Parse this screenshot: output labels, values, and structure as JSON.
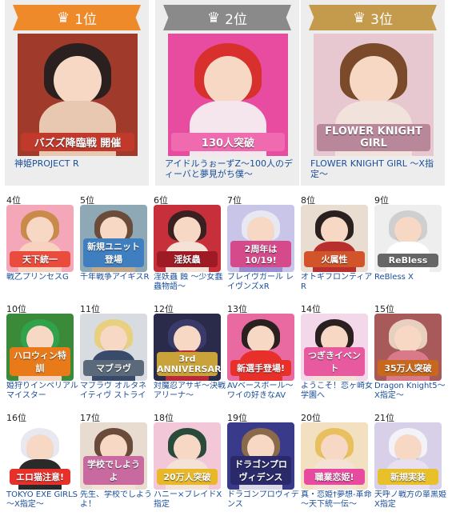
{
  "top": [
    {
      "rank": "1位",
      "title": "神姫PROJECT R",
      "badge": "バズズ降臨戦 開催",
      "ribbon_color": "#ee8a2a",
      "bg": "#a03a2a",
      "hair": "#2a2020",
      "body": "#e8c8b0",
      "badge_bg": "#c0392b"
    },
    {
      "rank": "2位",
      "title": "アイドルうぉーずZ～100人のディーバと夢見がち僕～",
      "badge": "130人突破",
      "ribbon_color": "#8a8a8a",
      "bg": "#e84ca0",
      "hair": "#d8302c",
      "body": "#f5e6ee",
      "badge_bg": "#f06ab0"
    },
    {
      "rank": "3位",
      "title": "FLOWER KNIGHT GIRL ～X指定～",
      "badge": "FLOWER KNIGHT GIRL",
      "ribbon_color": "#c49a4c",
      "bg": "#e8c8d0",
      "hair": "#7a4a2a",
      "body": "#f2e2dc",
      "badge_bg": "#b8889a"
    }
  ],
  "items": [
    {
      "rank": "4位",
      "title": "戦乙プリンセスG",
      "badge": "天下統一",
      "bg": "#f4a7b9",
      "hair": "#c98a4a",
      "body": "#f6d2bf",
      "badge_bg": "#e94b3c"
    },
    {
      "rank": "5位",
      "title": "千年戦争アイギスR",
      "badge": "新規ユニット登場",
      "bg": "#8fa8b5",
      "hair": "#6b4b3a",
      "body": "#c4a88a",
      "badge_bg": "#3f7fbf"
    },
    {
      "rank": "6位",
      "title": "淫妖蟲 蝕 ～少女蠢蟲物語～",
      "badge": "淫妖蟲",
      "bg": "#c7303a",
      "hair": "#3a2020",
      "body": "#f4e2d6",
      "badge_bg": "#9e1b25"
    },
    {
      "rank": "7位",
      "title": "ブレイヴガール レイヴンズxR",
      "badge": "2周年は10/19!",
      "bg": "#c9c5e8",
      "hair": "#e8e8f2",
      "body": "#9a8fd0",
      "badge_bg": "#d44a8a"
    },
    {
      "rank": "8位",
      "title": "オトギフロンティア R",
      "badge": "火属性",
      "bg": "#e9dcd0",
      "hair": "#2a2020",
      "body": "#b8302e",
      "badge_bg": "#d2542a"
    },
    {
      "rank": "9位",
      "title": "ReBless X",
      "badge": "ReBless",
      "bg": "#eeeeee",
      "hair": "#cfcfcf",
      "body": "#ffffff",
      "badge_bg": "#666666"
    },
    {
      "rank": "10位",
      "title": "姫狩りインペリアルマイスター",
      "badge": "ハロウィン特訓",
      "bg": "#3a8a3a",
      "hair": "#2fa24a",
      "body": "#f4d5c2",
      "badge_bg": "#e87a1a"
    },
    {
      "rank": "11位",
      "title": "マブラヴ オルタネイティヴ ストライ",
      "badge": "マブラヴ",
      "bg": "#d8dce0",
      "hair": "#e8d080",
      "body": "#3a4a6a",
      "badge_bg": "#5a6a7a"
    },
    {
      "rank": "12位",
      "title": "対魔忍アサギ～決戦アリーナ～",
      "badge": "3rd ANNIVERSARY",
      "bg": "#2a2a4a",
      "hair": "#3a3a6a",
      "body": "#b82a3a",
      "badge_bg": "#c9a23a"
    },
    {
      "rank": "13位",
      "title": "AVベースボール～ワイの好きなAV",
      "badge": "新選手登場!",
      "bg": "#e86aa0",
      "hair": "#2a2020",
      "body": "#e8302a",
      "badge_bg": "#e8302a"
    },
    {
      "rank": "14位",
      "title": "ようこそ！恋ヶ崎女学園へ",
      "badge": "つぎきイベント",
      "bg": "#f2d8e8",
      "hair": "#2a2020",
      "body": "#f4e2d6",
      "badge_bg": "#e85aa0"
    },
    {
      "rank": "15位",
      "title": "Dragon Knight5～X指定～",
      "badge": "35万人突破",
      "bg": "#a85a5a",
      "hair": "#e8d0c0",
      "body": "#d87a8a",
      "badge_bg": "#c8681e"
    },
    {
      "rank": "16位",
      "title": "TOKYO EXE GIRLS ～X指定～",
      "badge": "エロ猫注意!",
      "bg": "#ffffff",
      "hair": "#e8e8f0",
      "body": "#2a2a2a",
      "badge_bg": "#e8302a"
    },
    {
      "rank": "17位",
      "title": "先生、学校でしようよ！",
      "badge": "学校でしようよ",
      "bg": "#e8dcd0",
      "hair": "#6a4a3a",
      "body": "#f4e2d6",
      "badge_bg": "#c86aa0"
    },
    {
      "rank": "18位",
      "title": "ハニー×ブレイドX指定",
      "badge": "20万人突破",
      "bg": "#f2c8d8",
      "hair": "#2a4a3a",
      "body": "#f4e2d6",
      "badge_bg": "#e8b82a"
    },
    {
      "rank": "19位",
      "title": "ドラゴンプロヴィデンス",
      "badge": "ドラゴンプロヴィデンス",
      "bg": "#3a3a8a",
      "hair": "#8a6a4a",
      "body": "#d8d8e8",
      "badge_bg": "#2a2a6a"
    },
    {
      "rank": "20位",
      "title": "真・恋姫†夢想-革命～天下統一伝～",
      "badge": "職業恋姫!",
      "bg": "#f2e0c0",
      "hair": "#e8c060",
      "body": "#f4e2d6",
      "badge_bg": "#e84aa0"
    },
    {
      "rank": "21位",
      "title": "天呼ノ戦方の箪黒姫 X指定",
      "badge": "新規実装",
      "bg": "#d8d0e8",
      "hair": "#f2f2f8",
      "body": "#e8e0f0",
      "badge_bg": "#e8c02a"
    }
  ]
}
